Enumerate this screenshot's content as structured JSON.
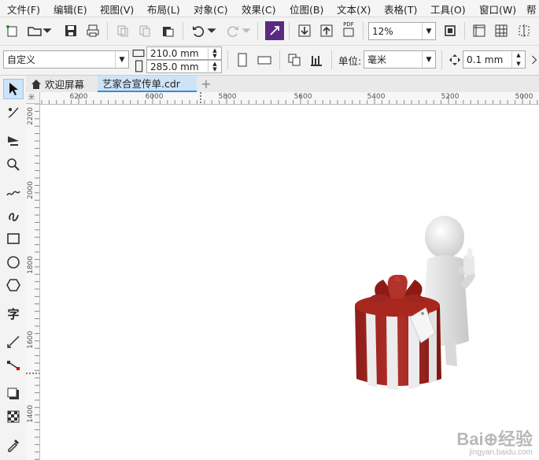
{
  "menu": {
    "items": [
      "文件(F)",
      "编辑(E)",
      "视图(V)",
      "布局(L)",
      "对象(C)",
      "效果(C)",
      "位图(B)",
      "文本(X)",
      "表格(T)",
      "工具(O)",
      "窗口(W)",
      "帮"
    ]
  },
  "toolbar": {
    "pdf_label": "PDF",
    "zoom_value": "12%"
  },
  "property_bar": {
    "page_preset": "自定义",
    "width_value": "210.0 mm",
    "height_value": "285.0 mm",
    "units_label": "单位:",
    "units_value": "毫米",
    "nudge_value": "0.1 mm"
  },
  "tabs": {
    "welcome": "欢迎屏幕",
    "document": "艺家合宣传单.cdr",
    "add": "+"
  },
  "rulers": {
    "horizontal_labels": [
      "6200",
      "6000",
      "5800",
      "5600",
      "5400",
      "5200",
      "5000"
    ],
    "vertical_labels": [
      "2200",
      "2000",
      "1800",
      "1600",
      "1400"
    ],
    "corner_label": "米"
  },
  "toolbox": {
    "text_tool_glyph": "字"
  },
  "watermark": {
    "brand": "Bai⊕经验",
    "url": "jingyan.baidu.com"
  },
  "colors": {
    "gift_red": "#a3241f",
    "figure_gray": "#e8e8e8",
    "accent_purple": "#5a2a82",
    "tab_active": "#cde3f7"
  }
}
